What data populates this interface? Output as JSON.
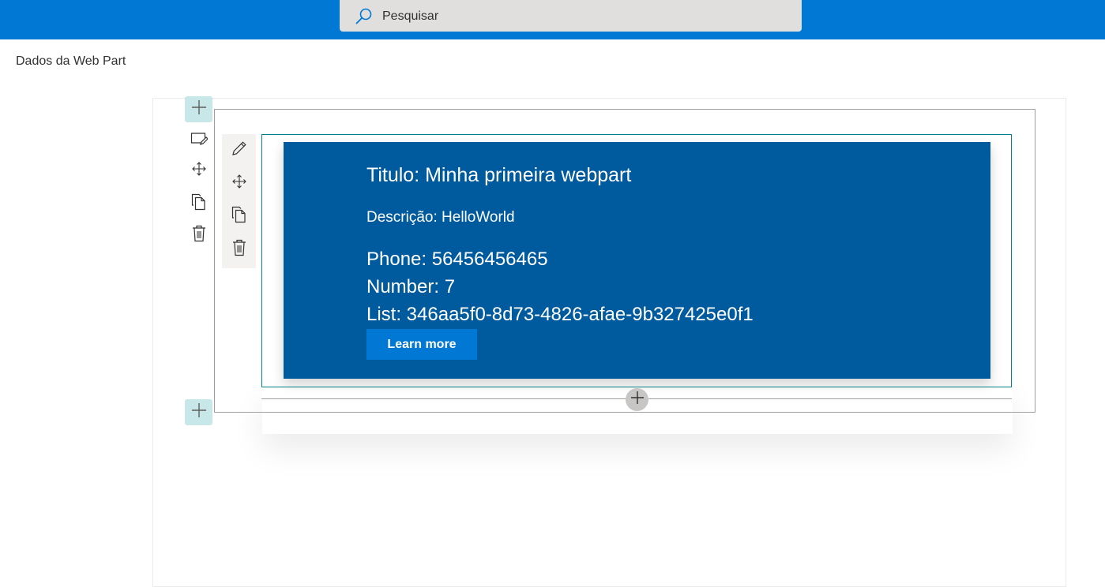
{
  "colors": {
    "topbar": "#0078d4",
    "webpart_bg": "#005a9e",
    "accent": "#0078d4",
    "add_button_bg": "#c7e7e9"
  },
  "search": {
    "placeholder": "Pesquisar",
    "icon": "search-icon"
  },
  "page": {
    "title": "Dados da Web Part"
  },
  "section_toolbar": {
    "icons": [
      "add-icon",
      "edit-section-icon",
      "move-icon",
      "duplicate-icon",
      "delete-icon",
      "add-icon"
    ]
  },
  "webpart_toolbar": {
    "icons": [
      "pencil-icon",
      "move-icon",
      "duplicate-icon",
      "delete-icon"
    ]
  },
  "webpart": {
    "title": "Titulo: Minha primeira webpart",
    "description": "Descrição: HelloWorld",
    "phone": "Phone: 56456456465",
    "number": "Number: 7",
    "list": "List: 346aa5f0-8d73-4826-afae-9b327425e0f1",
    "button_label": "Learn more"
  }
}
